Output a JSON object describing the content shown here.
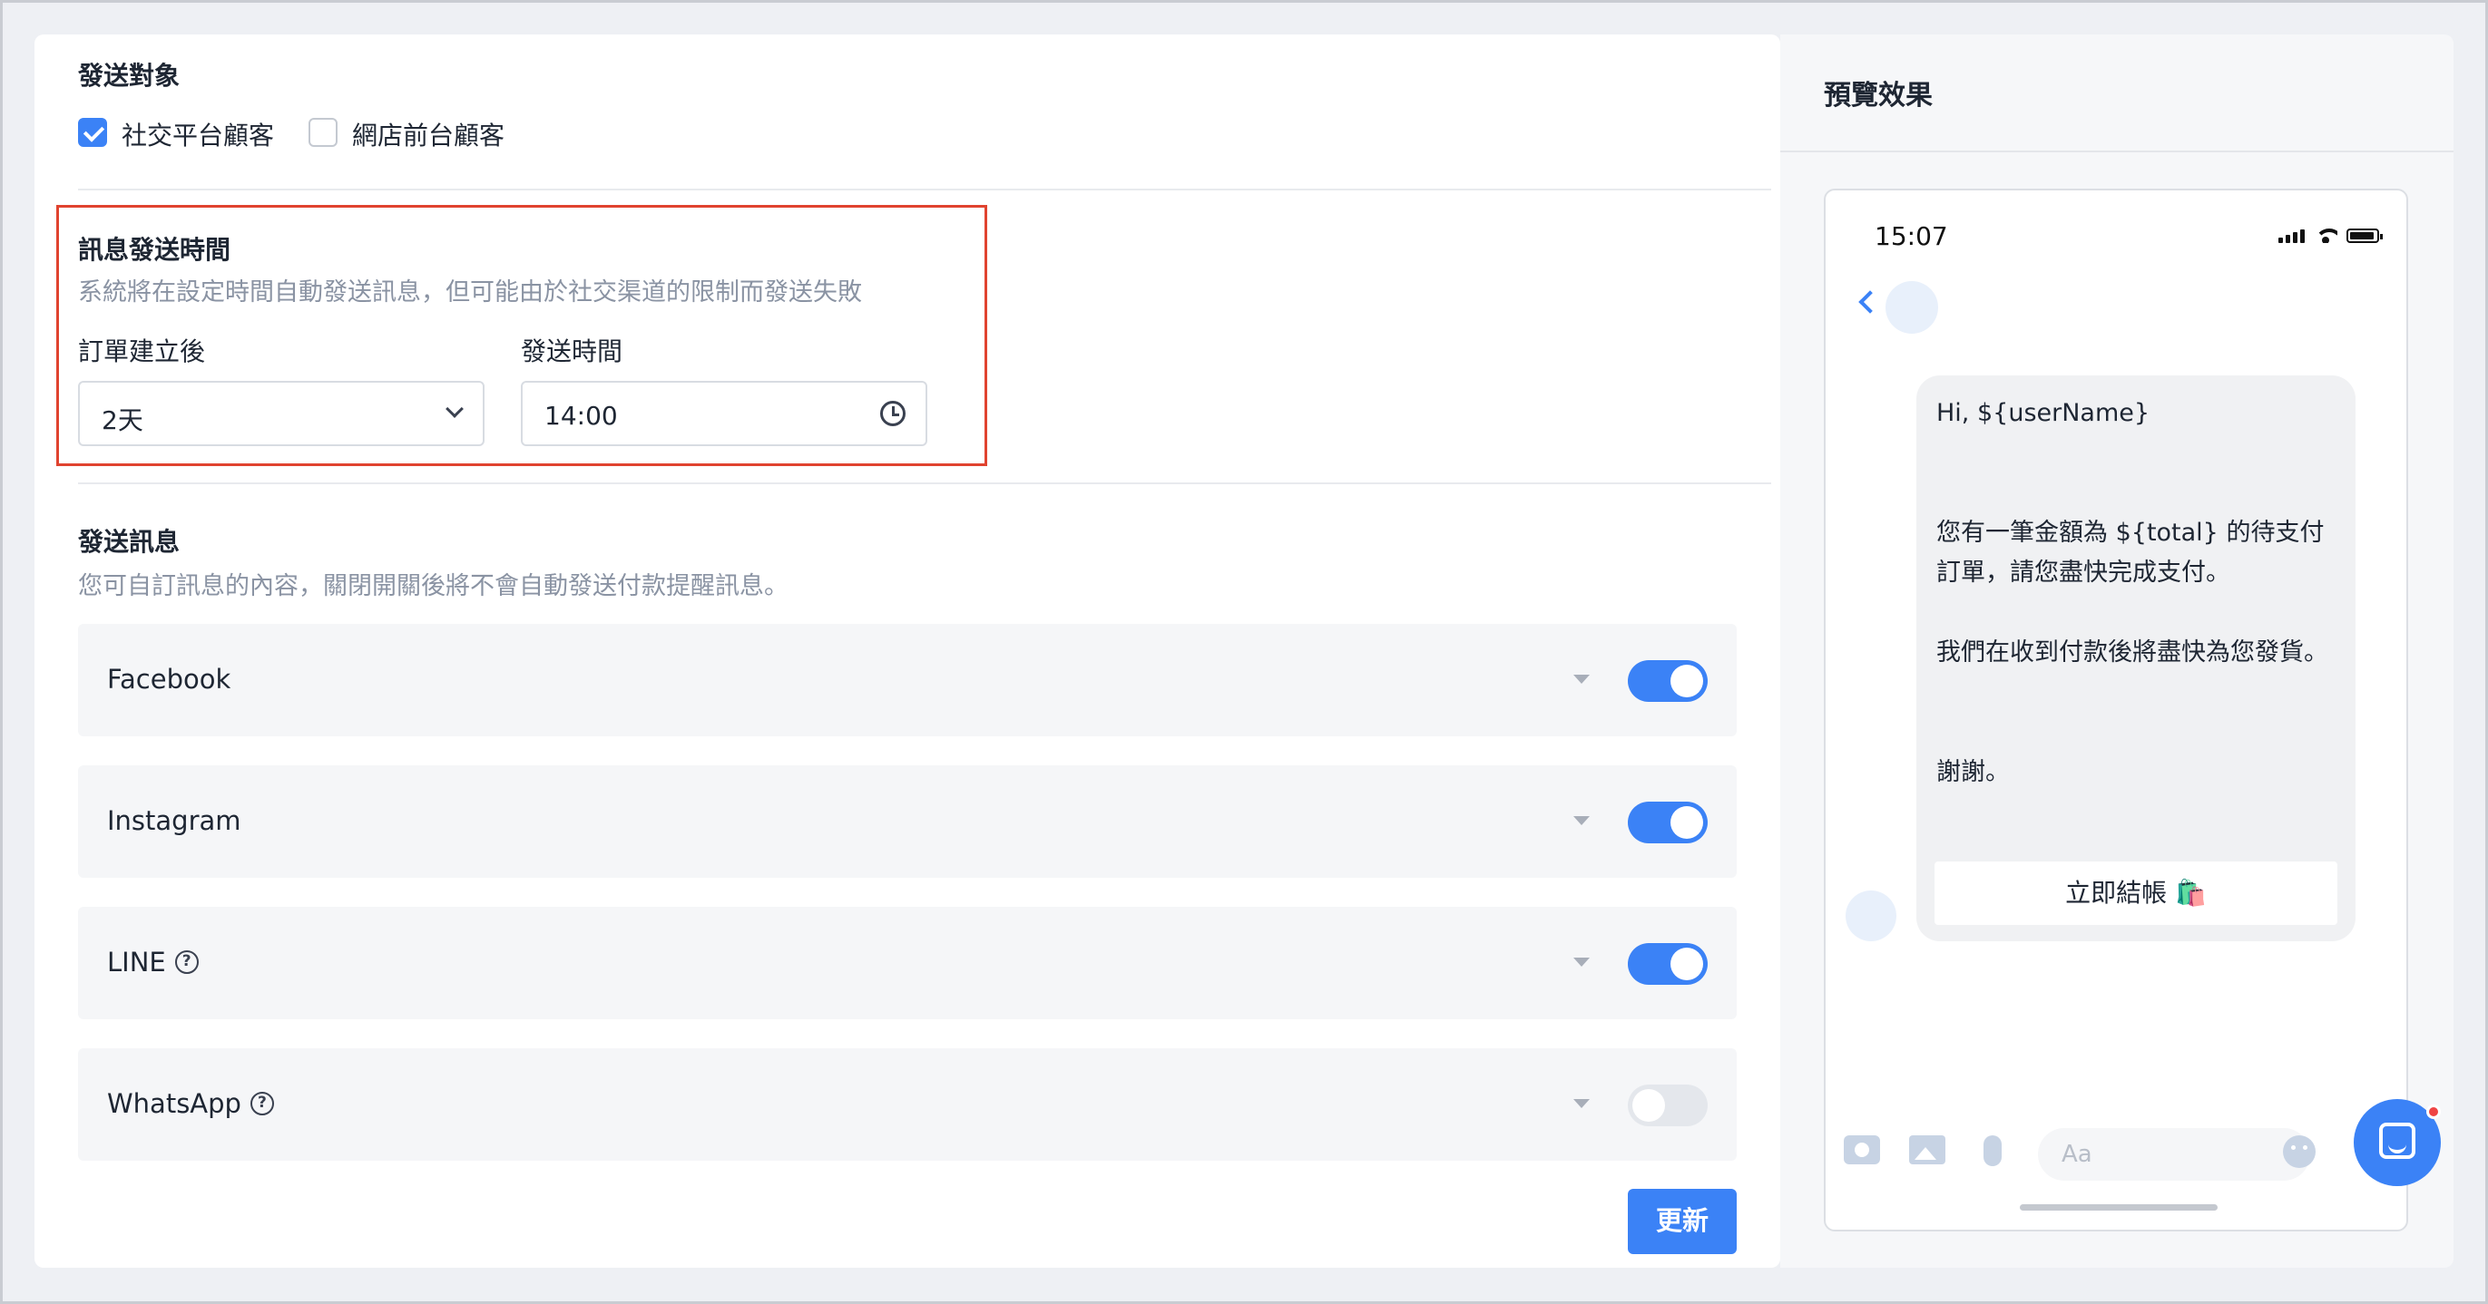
{
  "recipients": {
    "title": "發送對象",
    "options": [
      {
        "label": "社交平台顧客",
        "checked": true
      },
      {
        "label": "網店前台顧客",
        "checked": false
      }
    ]
  },
  "send_time": {
    "title": "訊息發送時間",
    "description": "系統將在設定時間自動發送訊息，但可能由於社交渠道的限制而發送失敗",
    "after_order_label": "訂單建立後",
    "after_order_value": "2天",
    "time_label": "發送時間",
    "time_value": "14:00"
  },
  "messages": {
    "title": "發送訊息",
    "description": "您可自訂訊息的內容，關閉開關後將不會自動發送付款提醒訊息。",
    "channels": [
      {
        "name": "Facebook",
        "enabled": true,
        "help": false
      },
      {
        "name": "Instagram",
        "enabled": true,
        "help": false
      },
      {
        "name": "LINE",
        "enabled": true,
        "help": true
      },
      {
        "name": "WhatsApp",
        "enabled": false,
        "help": true
      }
    ],
    "update_label": "更新"
  },
  "preview": {
    "title": "預覽效果",
    "status_time": "15:07",
    "message": "Hi, ${userName}\n\n\n您有一筆金額為 ${total} 的待支付訂單，請您盡快完成支付。\n\n我們在收到付款後將盡快為您發貨。\n\n\n謝謝。",
    "checkout_label": "立即結帳 🛍️",
    "input_placeholder": "Aa"
  },
  "colors": {
    "accent": "#3b82f6",
    "highlight_border": "#e0432f"
  }
}
